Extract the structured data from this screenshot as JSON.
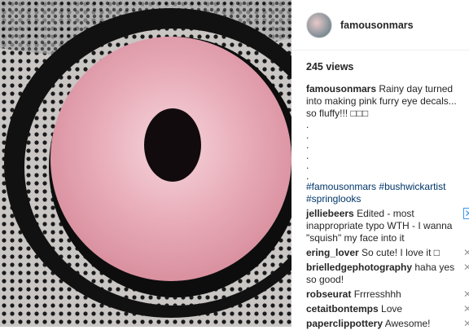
{
  "post": {
    "username": "famousonmars",
    "views": "245 views",
    "caption_text": "Rainy day turned into making pink furry eye decals... so fluffy!!! □□□",
    "dots": [
      ".",
      ".",
      ".",
      ".",
      ".",
      "."
    ],
    "hashtags": [
      "#famousonmars",
      "#bushwickartist",
      "#springlooks"
    ]
  },
  "comments": [
    {
      "user": "jelliebeers",
      "text": "Edited - most inappropriate typo WTH - I wanna \"squish\" my face into it"
    },
    {
      "user": "ering_lover",
      "text": "So cute! I love it □"
    },
    {
      "user": "brielledgephotography",
      "text": "haha yes so good!"
    },
    {
      "user": "robseurat",
      "text": "Frrresshhh"
    },
    {
      "user": "cetaitbontemps",
      "text": "Love"
    },
    {
      "user": "paperclippottery",
      "text": "Awesome!"
    }
  ],
  "icons": {
    "delete": "✕"
  }
}
